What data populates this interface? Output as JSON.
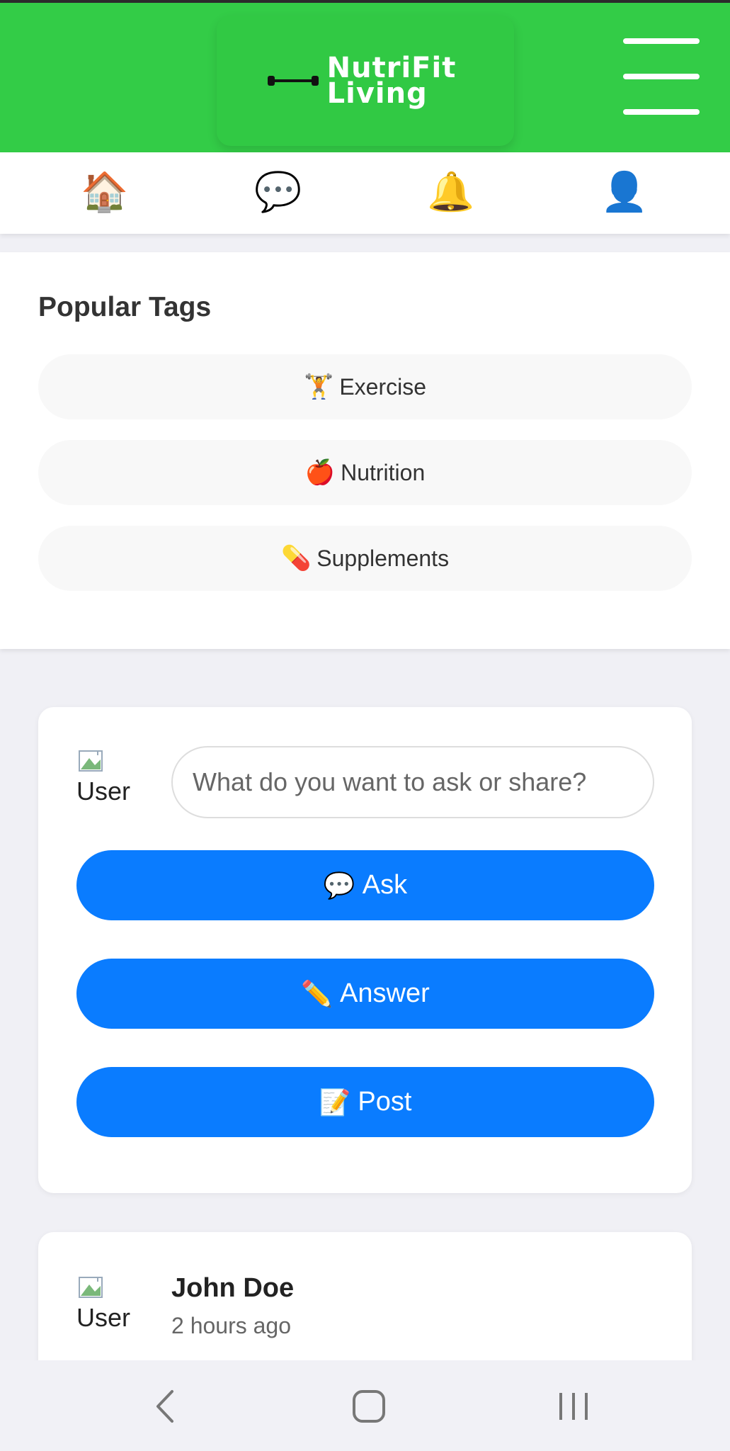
{
  "header": {
    "brand_line1": "NutriFit",
    "brand_line2": "Living",
    "brand_color": "#33cc47",
    "logo_icon": "dumbbell-icon",
    "menu_icon": "hamburger-menu-icon"
  },
  "nav": {
    "items": [
      {
        "name": "home",
        "icon": "🏠"
      },
      {
        "name": "messages",
        "icon": "💬"
      },
      {
        "name": "notifications",
        "icon": "🔔"
      },
      {
        "name": "profile",
        "icon": "👤"
      }
    ]
  },
  "tags": {
    "title": "Popular Tags",
    "items": [
      {
        "emoji": "🏋",
        "label": "Exercise"
      },
      {
        "emoji": "🍎",
        "label": "Nutrition"
      },
      {
        "emoji": "💊",
        "label": "Supplements"
      }
    ]
  },
  "composer": {
    "avatar_alt": "User",
    "placeholder": "What do you want to ask or share?",
    "buttons": [
      {
        "emoji": "💬",
        "label": "Ask"
      },
      {
        "emoji": "✏️",
        "label": "Answer"
      },
      {
        "emoji": "📝",
        "label": "Post"
      }
    ],
    "button_color": "#0a7cff"
  },
  "post": {
    "avatar_alt": "User",
    "author": "John Doe",
    "time": "2 hours ago"
  },
  "system_nav": {
    "back_icon": "back-chevron-icon",
    "home_icon": "home-square-icon",
    "recents_icon": "recents-bars-icon"
  }
}
